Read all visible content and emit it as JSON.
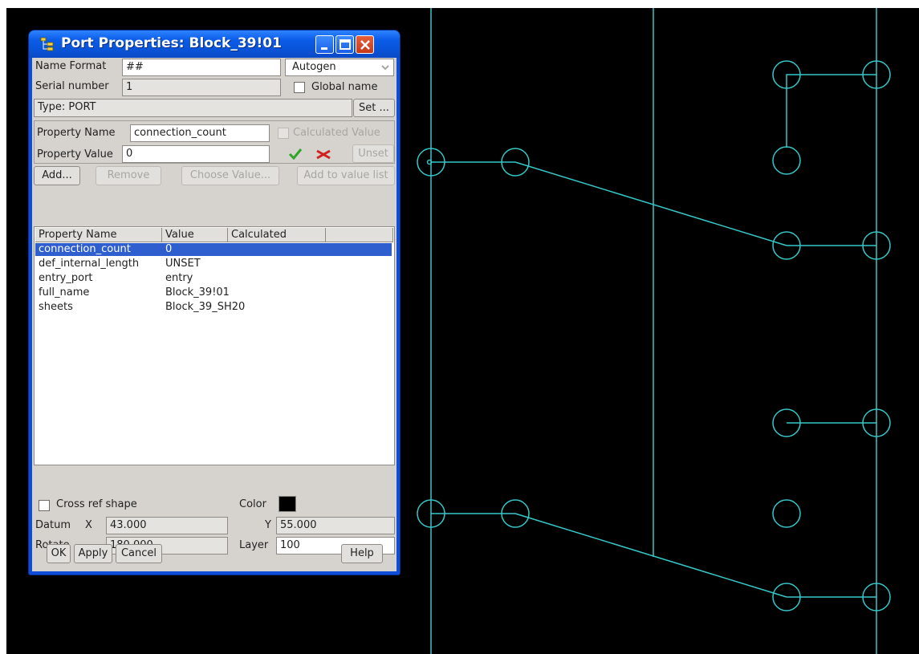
{
  "window": {
    "title": "Port Properties: Block_39!01"
  },
  "form": {
    "name_format_label": "Name Format",
    "name_format_value": "##",
    "autogen_option": "Autogen",
    "serial_number_label": "Serial number",
    "serial_number_value": "1",
    "global_name_label": "Global name",
    "type_label": "Type: PORT",
    "set_button": "Set ...",
    "property_name_label": "Property Name",
    "property_name_value": "connection_count",
    "calculated_value_label": "Calculated Value",
    "property_value_label": "Property Value",
    "property_value_value": "0",
    "unset_button": "Unset"
  },
  "actions": {
    "add": "Add...",
    "remove": "Remove",
    "choose_value": "Choose Value...",
    "add_to_value_list": "Add to value list"
  },
  "table": {
    "columns": [
      "Property Name",
      "Value",
      "Calculated"
    ],
    "rows": [
      {
        "name": "connection_count",
        "value": "0",
        "selected": true
      },
      {
        "name": "def_internal_length",
        "value": "UNSET",
        "selected": false
      },
      {
        "name": "entry_port",
        "value": "entry",
        "selected": false
      },
      {
        "name": "full_name",
        "value": "Block_39!01",
        "selected": false
      },
      {
        "name": "sheets",
        "value": "Block_39_SH20",
        "selected": false
      }
    ]
  },
  "bottom": {
    "cross_ref_label": "Cross ref shape",
    "color_label": "Color",
    "color_value": "#000000",
    "datum_label": "Datum",
    "x_label": "X",
    "x_value": "43.000",
    "y_label": "Y",
    "y_value": "55.000",
    "rotate_label": "Rotate",
    "rotate_value": "180.000",
    "layer_label": "Layer",
    "layer_value": "100"
  },
  "buttons": {
    "ok": "OK",
    "apply": "Apply",
    "cancel": "Cancel",
    "help": "Help"
  },
  "colors": {
    "canvas_background": "#000000",
    "wire": "#36c8c8",
    "selection": "#2f5fcf",
    "titlebar": "#0954d8"
  }
}
